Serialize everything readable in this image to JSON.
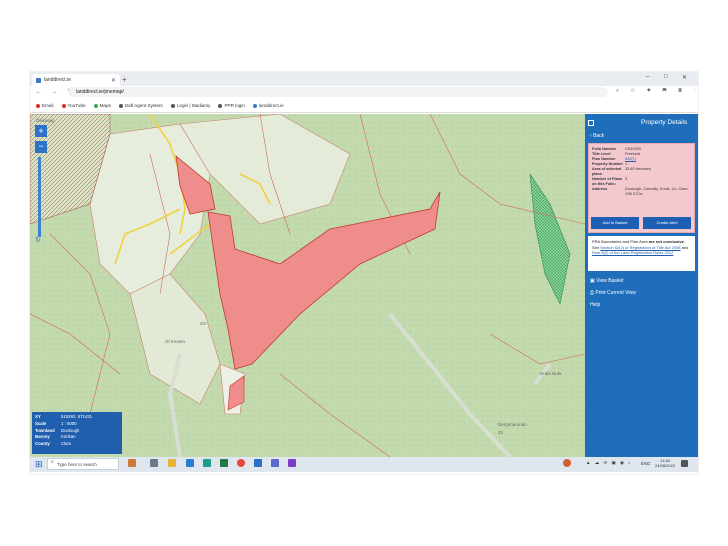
{
  "browser": {
    "tab_title": "landdirect.ie",
    "new_tab": "+",
    "url": "landdirect.ie/pnemap/",
    "window_controls": [
      "–",
      "□",
      "✕"
    ],
    "nav_icons": "← → ↻",
    "right_icons": "⌕ ☆ ✦ ⚑ ▣ ⋮",
    "bookmarks": [
      {
        "label": "Email",
        "color": "#d93025"
      },
      {
        "label": "YouTube",
        "color": "#e02626"
      },
      {
        "label": "Maps",
        "color": "#34a853"
      },
      {
        "label": "Daft Agent System",
        "color": "#555555"
      },
      {
        "label": "Login | Madiamy",
        "color": "#555555"
      },
      {
        "label": "PPR login",
        "color": "#555555"
      },
      {
        "label": "landdirect.ie",
        "color": "#3b77c9"
      }
    ]
  },
  "map": {
    "zoom_in": "+",
    "zoom_out": "−",
    "refresh_icon": "↻",
    "top_left_label": "Gleninag",
    "labels": [
      "Zm",
      "Gl Knoten",
      "Drabi Nulu",
      "Derrymaurnan",
      "Zn"
    ],
    "info": [
      {
        "key": "XY",
        "value": "515292, 671431"
      },
      {
        "key": "Scale",
        "value": "1 : 5000"
      },
      {
        "key": "Townland",
        "value": "Doolough"
      },
      {
        "key": "Barony",
        "value": "Kirrikan"
      },
      {
        "key": "County",
        "value": "Clare"
      }
    ]
  },
  "panel": {
    "title": "Property Details",
    "back_label": "Back",
    "details": [
      {
        "key": "Folio Number",
        "value": "CE40309"
      },
      {
        "key": "Title Level",
        "value": "Freehold"
      },
      {
        "key": "Plan Number",
        "value": "632(1)"
      },
      {
        "key": "Property Number",
        "value": "1"
      },
      {
        "key": "Area of selected plans",
        "value": "33.60 Hectares"
      },
      {
        "key": "Number of Plans on this Folio:",
        "value": "3"
      },
      {
        "key": "Address",
        "value": "Doolough, Connolly, Ennis, Co. Clare, V95 X7Ca"
      }
    ],
    "add_basket": "Add to Basket",
    "create_alert": "Create Alert",
    "note_part1": "PRA Boundaries and Plan Area",
    "note_bold": "are not conclusive",
    "note_part2": "See",
    "note_link1": "Section 62(2) of Registration of Title Act 2006",
    "note_and": "and",
    "note_link2": "Rule 8(2) of the Land Registration Rules 2012",
    "links": [
      "View Basket",
      "Print Current View",
      "Help"
    ]
  },
  "taskbar": {
    "search_placeholder": "Type here to search",
    "tray_icons": "▲ ☁ ✉ ▣ ◉ ♪",
    "language": "ENG",
    "time": "11:46",
    "date": "24/08/2022"
  }
}
